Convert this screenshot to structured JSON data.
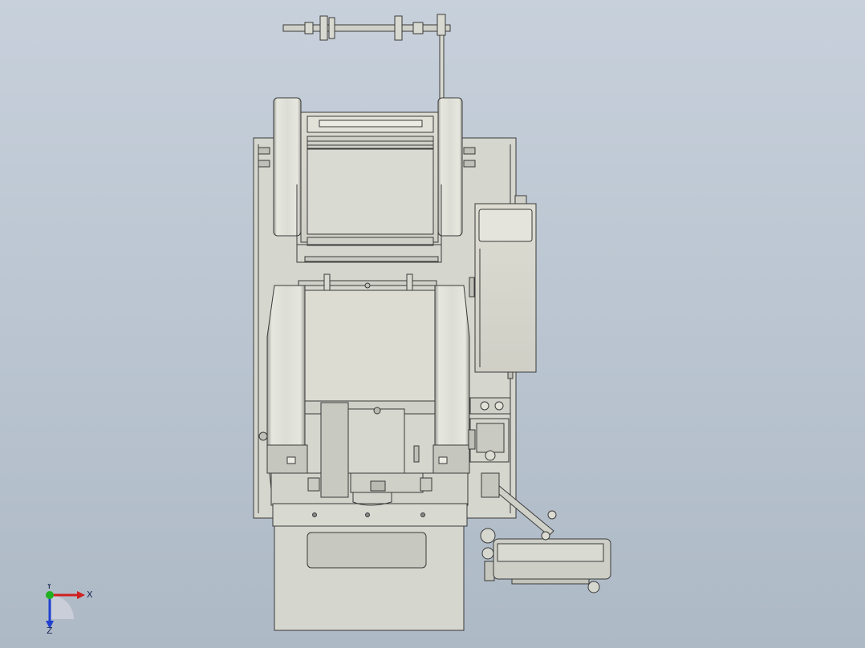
{
  "view": {
    "background_top": "#c7d0db",
    "background_bottom": "#aeb9c6",
    "model_color": "#d8d9d0",
    "edge_color": "#3a3a3a"
  },
  "triad": {
    "x_label": "X",
    "y_label": "Y",
    "z_label": "Z",
    "x_color": "#d02020",
    "y_color": "#20b020",
    "z_color": "#2040d0"
  }
}
